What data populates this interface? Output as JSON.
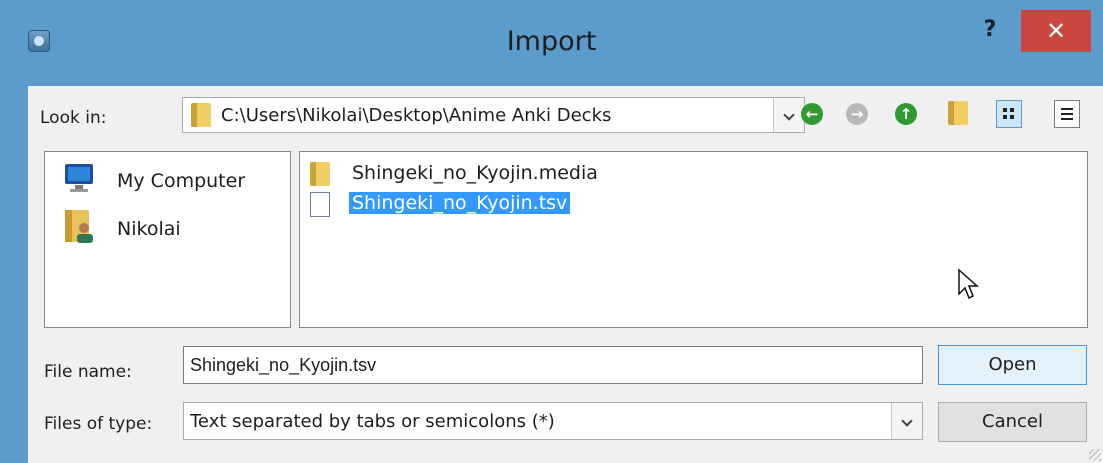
{
  "window": {
    "title": "Import",
    "help_label": "?",
    "close_label": "✕"
  },
  "lookin": {
    "label": "Look in:",
    "path": "C:\\Users\\Nikolai\\Desktop\\Anime Anki Decks"
  },
  "toolbar": {
    "back_icon": "back-arrow-icon",
    "forward_icon": "forward-arrow-icon",
    "up_icon": "up-arrow-icon",
    "new_folder_icon": "new-folder-icon",
    "list_view_icon": "list-view-icon",
    "detail_view_icon": "detail-view-icon",
    "active_view": "list"
  },
  "places": [
    {
      "label": "My Computer",
      "icon": "computer-icon"
    },
    {
      "label": "Nikolai",
      "icon": "user-folder-icon"
    }
  ],
  "files": [
    {
      "name": "Shingeki_no_Kyojin.media",
      "icon": "folder-icon",
      "selected": false
    },
    {
      "name": "Shingeki_no_Kyojin.tsv",
      "icon": "document-icon",
      "selected": true
    }
  ],
  "filename": {
    "label": "File name:",
    "value": "Shingeki_no_Kyojin.tsv"
  },
  "filetype": {
    "label": "Files of type:",
    "value": "Text separated by tabs or semicolons (*)"
  },
  "buttons": {
    "open": "Open",
    "cancel": "Cancel"
  },
  "colors": {
    "titlebar": "#5b9ccd",
    "close": "#c9473d",
    "selection": "#3399ff"
  }
}
